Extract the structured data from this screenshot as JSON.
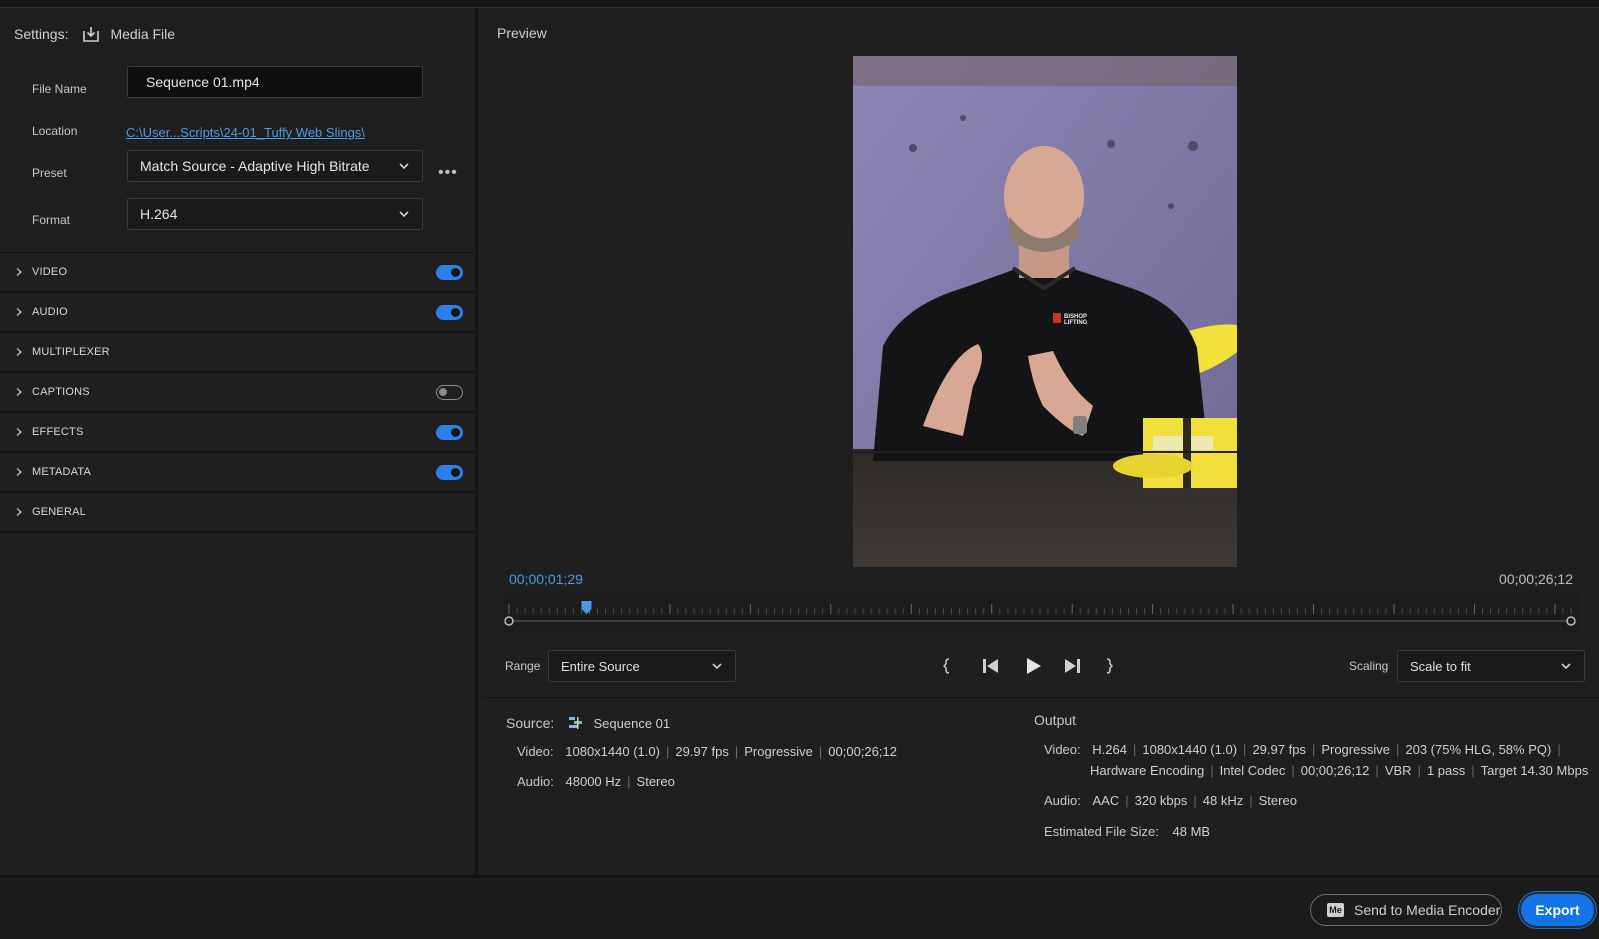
{
  "settings": {
    "label": "Settings:",
    "media_file": "Media File",
    "file_name_label": "File Name",
    "file_name_value": "Sequence 01.mp4",
    "location_label": "Location",
    "location_value": "C:\\User...Scripts\\24-01_Tuffy Web Slings\\",
    "preset_label": "Preset",
    "preset_value": "Match Source - Adaptive High Bitrate",
    "format_label": "Format",
    "format_value": "H.264",
    "more_label": "•••"
  },
  "sections": [
    {
      "name": "VIDEO",
      "toggle": "on"
    },
    {
      "name": "AUDIO",
      "toggle": "on"
    },
    {
      "name": "MULTIPLEXER",
      "toggle": "none"
    },
    {
      "name": "CAPTIONS",
      "toggle": "off"
    },
    {
      "name": "EFFECTS",
      "toggle": "on"
    },
    {
      "name": "METADATA",
      "toggle": "on"
    },
    {
      "name": "GENERAL",
      "toggle": "none"
    }
  ],
  "preview": {
    "title": "Preview",
    "current_time": "00;00;01;29",
    "duration": "00;00;26;12",
    "playhead_fraction": 0.073,
    "range_label": "Range",
    "range_value": "Entire Source",
    "scaling_label": "Scaling",
    "scaling_value": "Scale to fit",
    "shirt_logo": "BISHOP LIFTING"
  },
  "source": {
    "label": "Source:",
    "name": "Sequence 01",
    "video_label": "Video:",
    "video_parts": [
      "1080x1440 (1.0)",
      "29.97 fps",
      "Progressive",
      "00;00;26;12"
    ],
    "audio_label": "Audio:",
    "audio_parts": [
      "48000 Hz",
      "Stereo"
    ]
  },
  "output": {
    "label": "Output",
    "video_label": "Video:",
    "video_parts_line1": [
      "H.264",
      "1080x1440 (1.0)",
      "29.97 fps",
      "Progressive",
      "203 (75% HLG, 58% PQ)"
    ],
    "video_parts_line2": [
      "Hardware Encoding",
      "Intel Codec",
      "00;00;26;12",
      "VBR",
      "1 pass",
      "Target 14.30 Mbps"
    ],
    "audio_label": "Audio:",
    "audio_parts": [
      "AAC",
      "320 kbps",
      "48 kHz",
      "Stereo"
    ],
    "size_label": "Estimated File Size:",
    "size_value": "48 MB"
  },
  "buttons": {
    "send_to_encoder": "Send to Media Encoder",
    "me_badge": "Me",
    "export": "Export"
  },
  "colors": {
    "accent": "#2f80ed",
    "link": "#4a9ae8",
    "export": "#1473e6"
  }
}
